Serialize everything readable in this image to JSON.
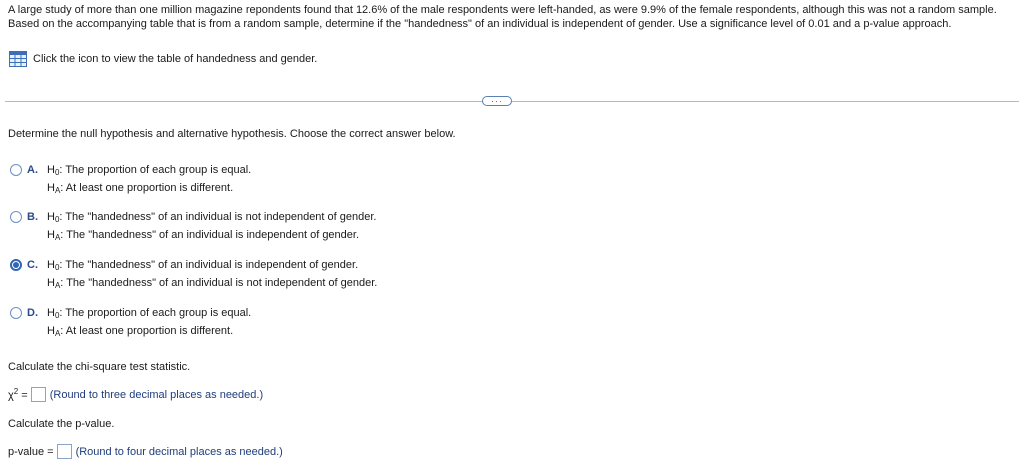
{
  "problem_text": "A large study of more than one million magazine repondents found that 12.6% of the male respondents were left-handed, as were 9.9% of the female respondents, although this was not a random sample. Based on the accompanying table that is from a random sample, determine if the \"handedness\" of an individual is independent of gender. Use a significance level of 0.01 and a p-value approach.",
  "table_link_text": "Click the icon to view the table of handedness and gender.",
  "more_button_label": "···",
  "question_text": "Determine the null hypothesis and alternative hypothesis. Choose the correct answer below.",
  "options": [
    {
      "letter": "A.",
      "h0_sym": "H",
      "h0_sub": "0",
      "h0": ": The proportion of each group is equal.",
      "ha_sym": "H",
      "ha_sub": "A",
      "ha": ": At least one proportion is different.",
      "selected": false
    },
    {
      "letter": "B.",
      "h0_sym": "H",
      "h0_sub": "0",
      "h0": ": The \"handedness\" of an individual is not independent of gender.",
      "ha_sym": "H",
      "ha_sub": "A",
      "ha": ": The \"handedness\" of an individual is independent of gender.",
      "selected": false
    },
    {
      "letter": "C.",
      "h0_sym": "H",
      "h0_sub": "0",
      "h0": ": The \"handedness\" of an individual is independent of gender.",
      "ha_sym": "H",
      "ha_sub": "A",
      "ha": ": The \"handedness\" of an individual is not independent of gender.",
      "selected": true
    },
    {
      "letter": "D.",
      "h0_sym": "H",
      "h0_sub": "0",
      "h0": ": The proportion of each group is equal.",
      "ha_sym": "H",
      "ha_sub": "A",
      "ha": ": At least one proportion is different.",
      "selected": false
    }
  ],
  "chi_task": "Calculate the chi-square test statistic.",
  "chi_label": "χ",
  "chi_sup": "2",
  "chi_eq": " =",
  "chi_hint": "(Round to three decimal places as needed.)",
  "chi_value": "",
  "p_task": "Calculate the p-value.",
  "p_label": "p-value =",
  "p_hint": "(Round to four decimal places as needed.)",
  "p_value": "",
  "colors": {
    "accent": "#2f66b4",
    "hint": "#1f3d7a",
    "divider": "#b8b8b8"
  },
  "icons": {
    "table": "table-grid-icon"
  }
}
